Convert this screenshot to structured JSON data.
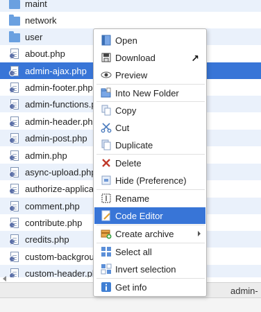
{
  "files": [
    {
      "name": "maint",
      "type": "folder"
    },
    {
      "name": "network",
      "type": "folder"
    },
    {
      "name": "user",
      "type": "folder"
    },
    {
      "name": "about.php",
      "type": "php"
    },
    {
      "name": "admin-ajax.php",
      "type": "php",
      "selected": true
    },
    {
      "name": "admin-footer.php",
      "type": "php"
    },
    {
      "name": "admin-functions.php",
      "type": "php"
    },
    {
      "name": "admin-header.php",
      "type": "php"
    },
    {
      "name": "admin-post.php",
      "type": "php"
    },
    {
      "name": "admin.php",
      "type": "php"
    },
    {
      "name": "async-upload.php",
      "type": "php"
    },
    {
      "name": "authorize-application.php",
      "type": "php"
    },
    {
      "name": "comment.php",
      "type": "php"
    },
    {
      "name": "contribute.php",
      "type": "php"
    },
    {
      "name": "credits.php",
      "type": "php"
    },
    {
      "name": "custom-background.php",
      "type": "php"
    },
    {
      "name": "custom-header.php",
      "type": "php"
    }
  ],
  "status": {
    "text": "admin-"
  },
  "menu": {
    "open": "Open",
    "download": "Download",
    "preview": "Preview",
    "into_new_folder": "Into New Folder",
    "copy": "Copy",
    "cut": "Cut",
    "duplicate": "Duplicate",
    "delete": "Delete",
    "hide": "Hide (Preference)",
    "rename": "Rename",
    "code_editor": "Code Editor",
    "create_archive": "Create archive",
    "select_all": "Select all",
    "invert_selection": "Invert selection",
    "get_info": "Get info"
  },
  "colors": {
    "selection": "#3875d7",
    "alt_row": "#eaf1fb"
  }
}
